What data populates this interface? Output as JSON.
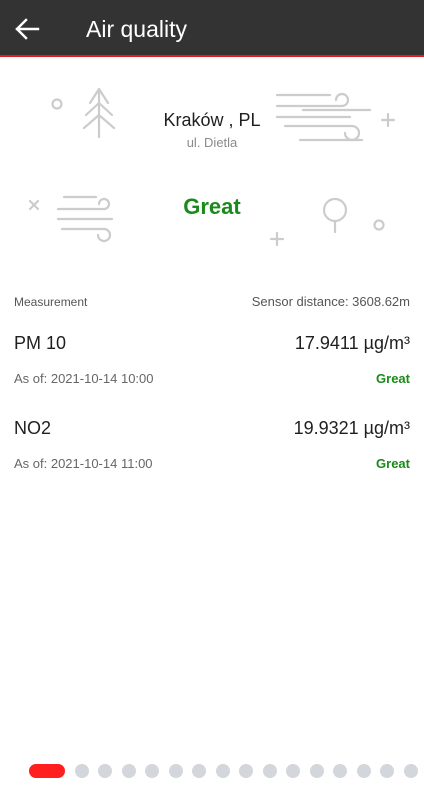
{
  "appbar": {
    "title": "Air quality",
    "back_icon": "arrow-left-icon"
  },
  "location": {
    "city": "Kraków , PL",
    "street": "ul. Dietla"
  },
  "overall": {
    "status": "Great",
    "status_color": "#1a8a1a"
  },
  "table": {
    "header_left": "Measurement",
    "header_right": "Sensor distance: 3608.62m",
    "rows": [
      {
        "name": "PM 10",
        "value": "17.9411 µg/m³",
        "as_of": "As of: 2021-10-14 10:00",
        "rating": "Great"
      },
      {
        "name": "NO2",
        "value": "19.9321 µg/m³",
        "as_of": "As of: 2021-10-14 11:00",
        "rating": "Great"
      }
    ]
  },
  "pager": {
    "total": 16,
    "active_index": 0,
    "active_color": "#ff1f1f",
    "inactive_color": "#d3d6db"
  },
  "colors": {
    "appbar": "#333333",
    "accent": "#e21c25",
    "decoration": "#cccccc"
  }
}
